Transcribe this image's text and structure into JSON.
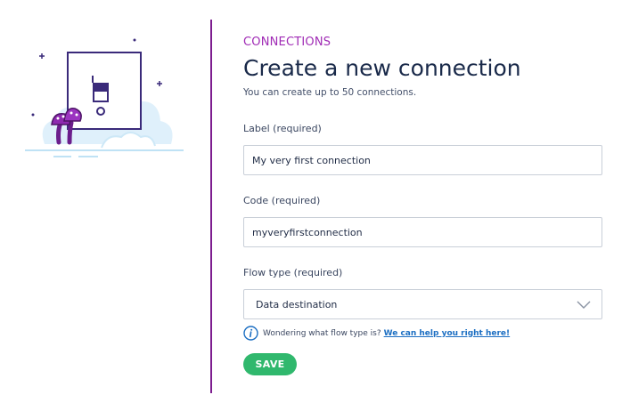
{
  "header": {
    "eyebrow": "CONNECTIONS",
    "title": "Create a new connection",
    "subtitle": "You can create up to 50 connections."
  },
  "form": {
    "label_field": {
      "label": "Label (required)",
      "value": "My very first connection"
    },
    "code_field": {
      "label": "Code (required)",
      "value": "myveryfirstconnection"
    },
    "flow_type_field": {
      "label": "Flow type (required)",
      "selected": "Data destination"
    },
    "help": {
      "text": "Wondering what flow type is?",
      "link": "We can help you right here!"
    },
    "save_label": "SAVE"
  },
  "icons": {
    "illustration": "light-switch-mushrooms-illustration",
    "select_arrow": "chevron-down-icon",
    "help": "info-icon"
  },
  "colors": {
    "accent": "#a02bb5",
    "divider": "#7d1d8f",
    "save_button": "#30b86d",
    "link": "#1b6ec2"
  }
}
